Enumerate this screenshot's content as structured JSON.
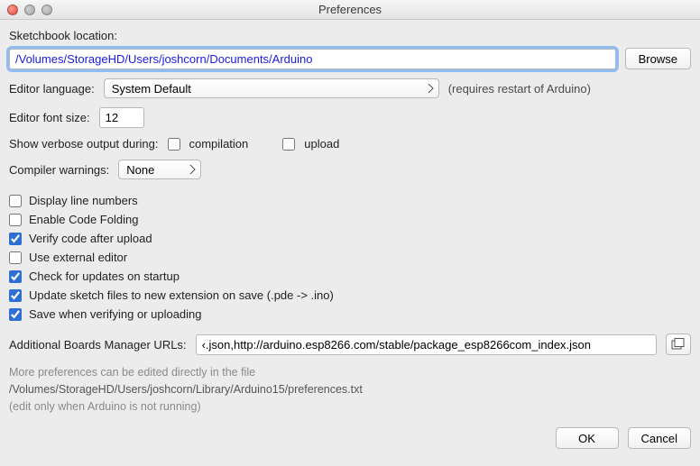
{
  "window": {
    "title": "Preferences"
  },
  "sketchbook": {
    "label": "Sketchbook location:",
    "value": "/Volumes/StorageHD/Users/joshcorn/Documents/Arduino",
    "browse": "Browse"
  },
  "editor_language": {
    "label": "Editor language:",
    "value": "System Default",
    "hint": "(requires restart of Arduino)"
  },
  "editor_font_size": {
    "label": "Editor font size:",
    "value": "12"
  },
  "verbose": {
    "label": "Show verbose output during:",
    "compilation_label": "compilation",
    "compilation_checked": false,
    "upload_label": "upload",
    "upload_checked": false
  },
  "compiler_warnings": {
    "label": "Compiler warnings:",
    "value": "None"
  },
  "checks": {
    "display_line_numbers": {
      "label": "Display line numbers",
      "checked": false
    },
    "enable_code_folding": {
      "label": "Enable Code Folding",
      "checked": false
    },
    "verify_code_after_upload": {
      "label": "Verify code after upload",
      "checked": true
    },
    "use_external_editor": {
      "label": "Use external editor",
      "checked": false
    },
    "check_for_updates": {
      "label": "Check for updates on startup",
      "checked": true
    },
    "update_sketch_files": {
      "label": "Update sketch files to new extension on save (.pde -> .ino)",
      "checked": true
    },
    "save_when_verifying": {
      "label": "Save when verifying or uploading",
      "checked": true
    }
  },
  "boards_urls": {
    "label": "Additional Boards Manager URLs:",
    "value": "‹.json,http://arduino.esp8266.com/stable/package_esp8266com_index.json"
  },
  "more_prefs": {
    "line1": "More preferences can be edited directly in the file",
    "path": "/Volumes/StorageHD/Users/joshcorn/Library/Arduino15/preferences.txt",
    "line3": "(edit only when Arduino is not running)"
  },
  "buttons": {
    "ok": "OK",
    "cancel": "Cancel"
  }
}
